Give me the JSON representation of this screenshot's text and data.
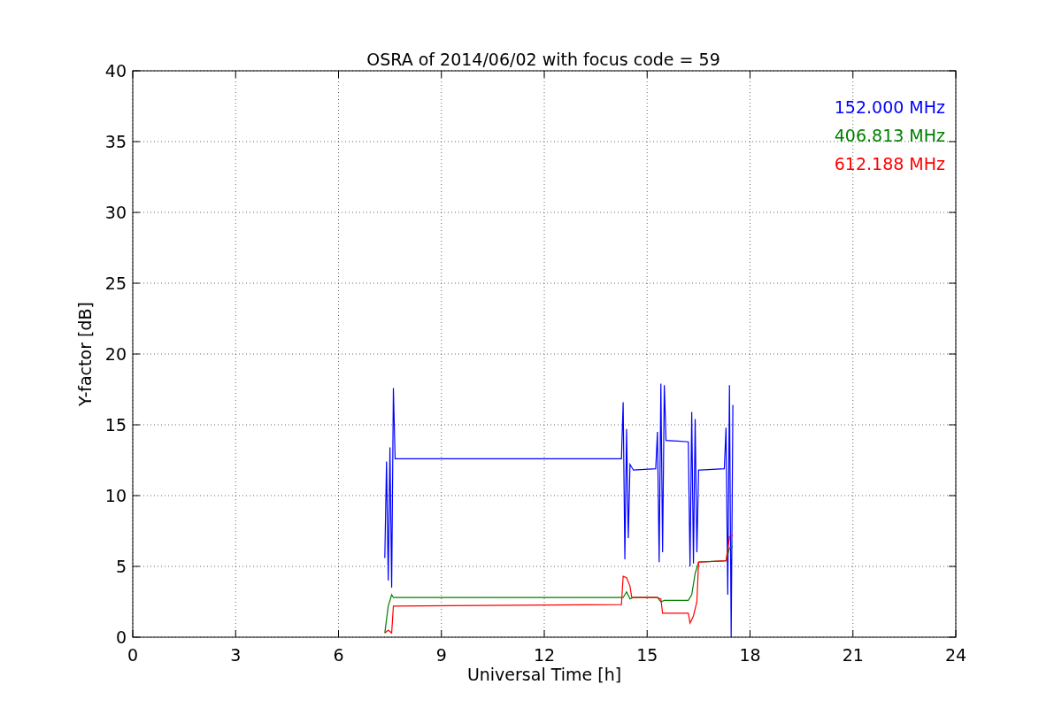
{
  "chart_data": {
    "type": "line",
    "title": "OSRA of 2014/06/02 with focus code = 59",
    "xlabel": "Universal Time [h]",
    "ylabel": "Y-factor [dB]",
    "xlim": [
      0,
      24
    ],
    "ylim": [
      0,
      40
    ],
    "xticks": [
      0,
      3,
      6,
      9,
      12,
      15,
      18,
      21,
      24
    ],
    "yticks": [
      0,
      5,
      10,
      15,
      20,
      25,
      30,
      35,
      40
    ],
    "grid": true,
    "series": [
      {
        "name": "152.000 MHz",
        "color": "#0000ff",
        "x": [
          7.35,
          7.4,
          7.45,
          7.5,
          7.55,
          7.6,
          7.65,
          14.25,
          14.3,
          14.35,
          14.4,
          14.45,
          14.5,
          14.6,
          15.25,
          15.3,
          15.35,
          15.4,
          15.45,
          15.5,
          15.55,
          16.2,
          16.25,
          16.3,
          16.35,
          16.4,
          16.45,
          16.5,
          16.55,
          17.25,
          17.3,
          17.35,
          17.4,
          17.45,
          17.5
        ],
        "values": [
          5.6,
          12.4,
          4.0,
          13.4,
          3.5,
          17.6,
          12.6,
          12.6,
          16.6,
          5.5,
          14.7,
          7.0,
          12.2,
          11.8,
          11.9,
          14.5,
          5.3,
          17.9,
          6.0,
          17.8,
          13.9,
          13.8,
          5.0,
          15.9,
          5.2,
          15.4,
          6.0,
          11.8,
          11.8,
          11.9,
          14.8,
          3.0,
          17.8,
          0.0,
          16.4
        ]
      },
      {
        "name": "406.813 MHz",
        "color": "#008000",
        "x": [
          7.35,
          7.45,
          7.55,
          7.6,
          14.3,
          14.4,
          14.5,
          14.6,
          15.3,
          15.4,
          15.5,
          16.2,
          16.3,
          16.4,
          16.5,
          17.3,
          17.4,
          17.5
        ],
        "values": [
          0.3,
          2.2,
          3.0,
          2.8,
          2.8,
          3.2,
          2.7,
          2.8,
          2.8,
          2.5,
          2.6,
          2.6,
          3.0,
          4.5,
          5.3,
          5.4,
          6.3,
          6.4
        ]
      },
      {
        "name": "612.188 MHz",
        "color": "#ff0000",
        "x": [
          7.35,
          7.45,
          7.55,
          7.6,
          14.25,
          14.3,
          14.4,
          14.5,
          14.55,
          15.3,
          15.4,
          15.45,
          16.2,
          16.25,
          16.35,
          16.45,
          16.5,
          17.3,
          17.4,
          17.5
        ],
        "values": [
          0.3,
          0.5,
          0.3,
          2.2,
          2.3,
          4.3,
          4.2,
          3.6,
          2.8,
          2.8,
          2.7,
          1.7,
          1.7,
          1.0,
          1.5,
          2.5,
          5.3,
          5.4,
          7.1,
          7.2
        ]
      }
    ]
  }
}
